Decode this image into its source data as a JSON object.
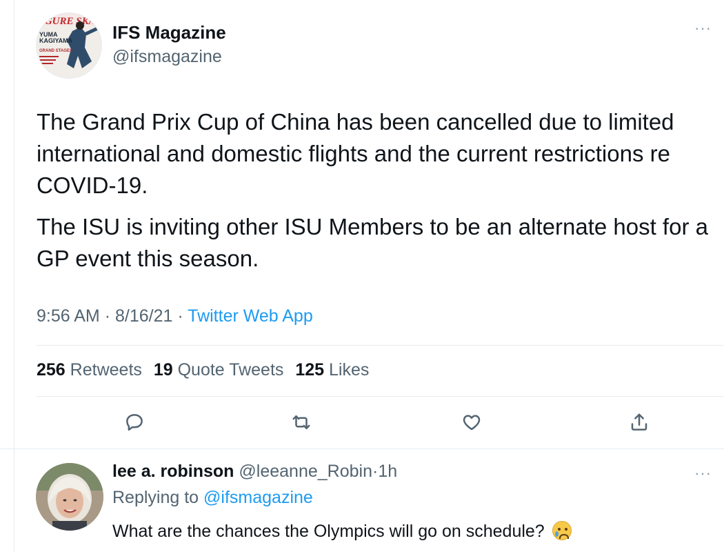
{
  "tweet": {
    "display_name": "IFS Magazine",
    "handle": "@ifsmagazine",
    "more": "···",
    "paragraphs": [
      "The Grand Prix Cup of China has been cancelled due to limited international and domestic flights and the current restrictions re COVID-19.",
      "The ISU is inviting other ISU Members to be an alternate host for a GP event this season."
    ],
    "time": "9:56 AM",
    "date": "8/16/21",
    "separator": "·",
    "source": "Twitter Web App",
    "stats": {
      "retweets_count": "256",
      "retweets_label": "Retweets",
      "quotes_count": "19",
      "quotes_label": "Quote Tweets",
      "likes_count": "125",
      "likes_label": "Likes"
    },
    "actions": [
      "reply-icon",
      "retweet-icon",
      "like-icon",
      "share-icon"
    ],
    "avatar_text": {
      "masthead": "IGURE SKATI",
      "name_line1": "YUMA",
      "name_line2": "KAGIYAMA",
      "caption": "GRAND STAGES"
    }
  },
  "reply": {
    "display_name": "lee  a. robinson",
    "handle": "@leeanne_Robin",
    "separator": "·",
    "time": "1h",
    "replying_prefix": "Replying to",
    "replying_to": "@ifsmagazine",
    "text": "What are the chances the Olympics will go on schedule?",
    "emoji": "crying-face",
    "more": "···"
  },
  "colors": {
    "text": "#0f1419",
    "secondary": "#536471",
    "link": "#1d9bf0",
    "divider": "#e6ecf0"
  }
}
